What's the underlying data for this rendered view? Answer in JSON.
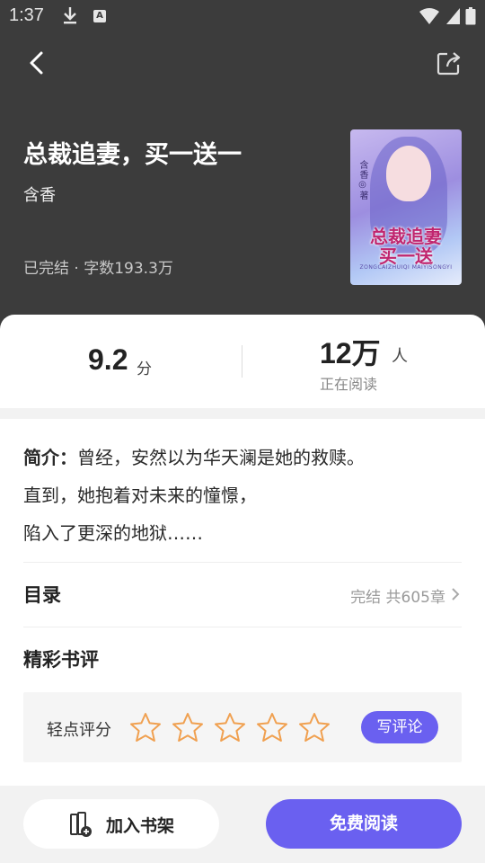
{
  "status_bar": {
    "time": "1:37",
    "badge": "A"
  },
  "header": {
    "title": "总裁追妻，买一送一",
    "author": "含香",
    "meta": "已完结 · 字数193.3万"
  },
  "cover": {
    "signature": "含香◎著",
    "title_line1": "总裁追妻",
    "title_line2": "买一送",
    "pinyin": "ZONGCAIZHUIQI MAIYISONGYI"
  },
  "stats": {
    "score": "9.2",
    "score_unit": "分",
    "readers": "12万",
    "readers_unit": "人",
    "readers_label": "正在阅读"
  },
  "intro": {
    "label": "简介：",
    "line1": "曾经，安然以为华天澜是她的救赎。",
    "line2": "直到，她抱着对未来的憧憬，",
    "line3": "陷入了更深的地狱……"
  },
  "toc": {
    "title": "目录",
    "info": "完结 共605章"
  },
  "reviews": {
    "title": "精彩书评",
    "rate_label": "轻点评分",
    "stars": 5,
    "rating": 0,
    "write_label": "写评论"
  },
  "bottom": {
    "shelf_label": "加入书架",
    "read_label": "免费阅读"
  },
  "colors": {
    "accent": "#6a60f0",
    "star": "#f0a050",
    "header_bg": "#3c3c3c"
  }
}
